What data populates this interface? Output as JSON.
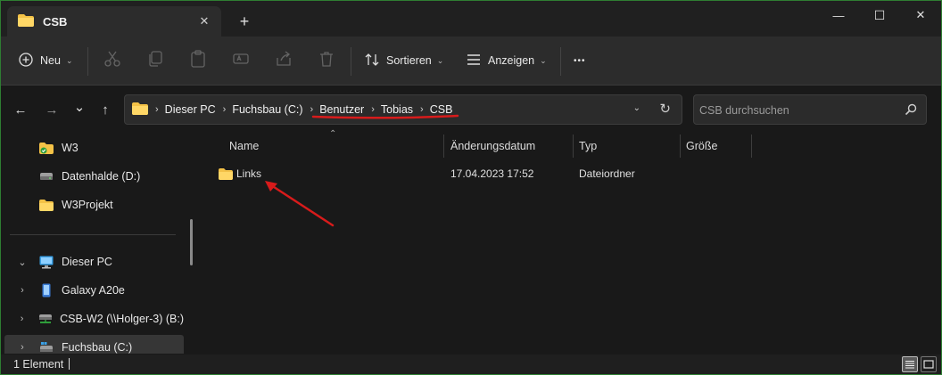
{
  "tab": {
    "title": "CSB",
    "close_glyph": "✕",
    "new_tab_glyph": "+"
  },
  "window_controls": {
    "minimize": "—",
    "maximize": "☐",
    "close": "✕"
  },
  "toolbar": {
    "new_label": "Neu",
    "sort_label": "Sortieren",
    "view_label": "Anzeigen",
    "more_glyph": "•••"
  },
  "nav": {
    "back": "←",
    "forward": "→",
    "recent": "⌄",
    "up": "↑"
  },
  "address": {
    "crumbs": [
      "Dieser PC",
      "Fuchsbau (C:)",
      "Benutzer",
      "Tobias",
      "CSB"
    ],
    "separator": "›"
  },
  "search": {
    "placeholder": "CSB durchsuchen"
  },
  "sidebar": {
    "items": [
      {
        "label": "W3",
        "icon": "folder-check-icon"
      },
      {
        "label": "Datenhalde (D:)",
        "icon": "drive-icon"
      },
      {
        "label": "W3Projekt",
        "icon": "folder-icon"
      },
      {
        "label": "Dieser PC",
        "icon": "computer-icon",
        "expander": "⌄"
      },
      {
        "label": "Galaxy A20e",
        "icon": "phone-icon",
        "expander": "›"
      },
      {
        "label": "CSB-W2 (\\\\Holger-3) (B:)",
        "icon": "network-drive-icon",
        "expander": "›"
      },
      {
        "label": "Fuchsbau (C:)",
        "icon": "system-drive-icon",
        "expander": "›"
      }
    ]
  },
  "columns": {
    "name": "Name",
    "modified": "Änderungsdatum",
    "type": "Typ",
    "size": "Größe",
    "sort_glyph": "⌃"
  },
  "files": [
    {
      "name": "Links",
      "modified": "17.04.2023 17:52",
      "type": "Dateiordner",
      "size": ""
    }
  ],
  "status": {
    "count": "1 Element"
  },
  "colors": {
    "folder": "#f4c247",
    "annotation_red": "#d81b1b",
    "accent_blue": "#4ea1f3"
  }
}
